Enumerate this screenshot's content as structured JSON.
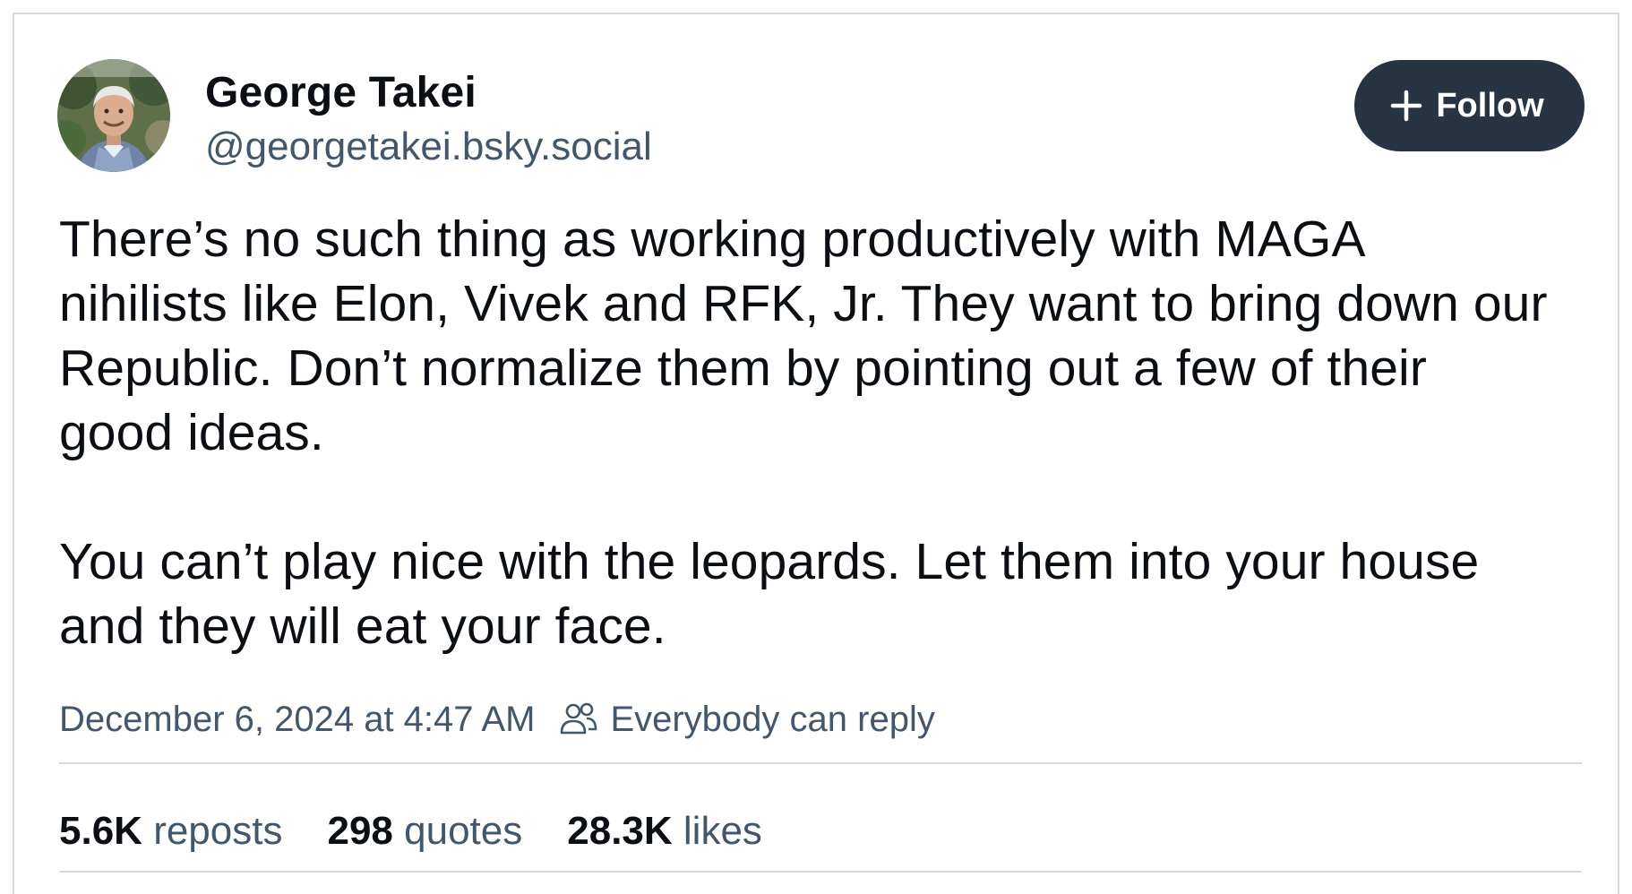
{
  "author": {
    "display_name": "George Takei",
    "handle": "@georgetakei.bsky.social",
    "avatar_icon": "avatar-photo"
  },
  "follow_button": {
    "label": "Follow",
    "icon": "plus-icon",
    "background": "#273444",
    "text_color": "#ffffff"
  },
  "post": {
    "text": "There’s no such thing as working productively with MAGA\nnihilists like Elon, Vivek and RFK, Jr. They want to bring down our\nRepublic. Don’t normalize them by pointing out a few of their\ngood ideas.\n\nYou can’t play nice with the leopards. Let them into your house\nand they will eat your face.",
    "timestamp": "December 6, 2024 at 4:47 AM",
    "reply_setting": "Everybody can reply",
    "reply_icon": "people-icon"
  },
  "stats": {
    "reposts": {
      "count": "5.6K",
      "label": "reposts"
    },
    "quotes": {
      "count": "298",
      "label": "quotes"
    },
    "likes": {
      "count": "28.3K",
      "label": "likes"
    }
  },
  "colors": {
    "text_primary": "#0b0f14",
    "text_secondary": "#42576c",
    "border": "#d4dbe2"
  }
}
